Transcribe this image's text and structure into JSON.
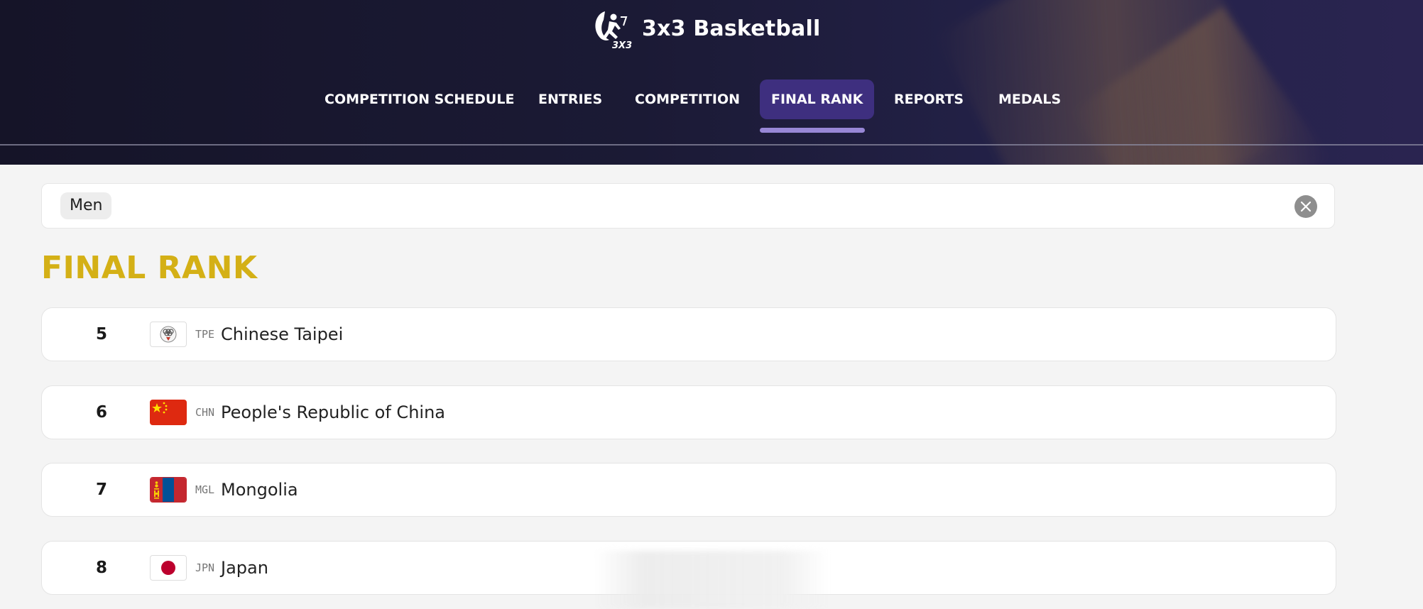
{
  "header": {
    "app_title": "3x3 Basketball",
    "logo_icon": "pictogram-icon",
    "nav": [
      {
        "label": "COMPETITION SCHEDULE",
        "active": false
      },
      {
        "label": "ENTRIES",
        "active": false
      },
      {
        "label": "COMPETITION",
        "active": false
      },
      {
        "label": "FINAL RANK",
        "active": true
      },
      {
        "label": "REPORTS",
        "active": false
      },
      {
        "label": "MEDALS",
        "active": false
      }
    ]
  },
  "filter": {
    "chip_label": "Men",
    "clear_icon": "close-circle-icon"
  },
  "section_title": "FINAL RANK",
  "rankings": [
    {
      "rank": "5",
      "code": "TPE",
      "name": "Chinese Taipei",
      "flag": "tpe-flag-icon"
    },
    {
      "rank": "6",
      "code": "CHN",
      "name": "People's Republic of China",
      "flag": "chn-flag-icon"
    },
    {
      "rank": "7",
      "code": "MGL",
      "name": "Mongolia",
      "flag": "mgl-flag-icon"
    },
    {
      "rank": "8",
      "code": "JPN",
      "name": "Japan",
      "flag": "jpn-flag-icon"
    }
  ],
  "colors": {
    "header_bg": "#1b1a35",
    "active_tab": "#3e2f7f",
    "underline": "#9887d6",
    "title_gold": "#d4b016",
    "page_bg": "#f4f4f4"
  }
}
